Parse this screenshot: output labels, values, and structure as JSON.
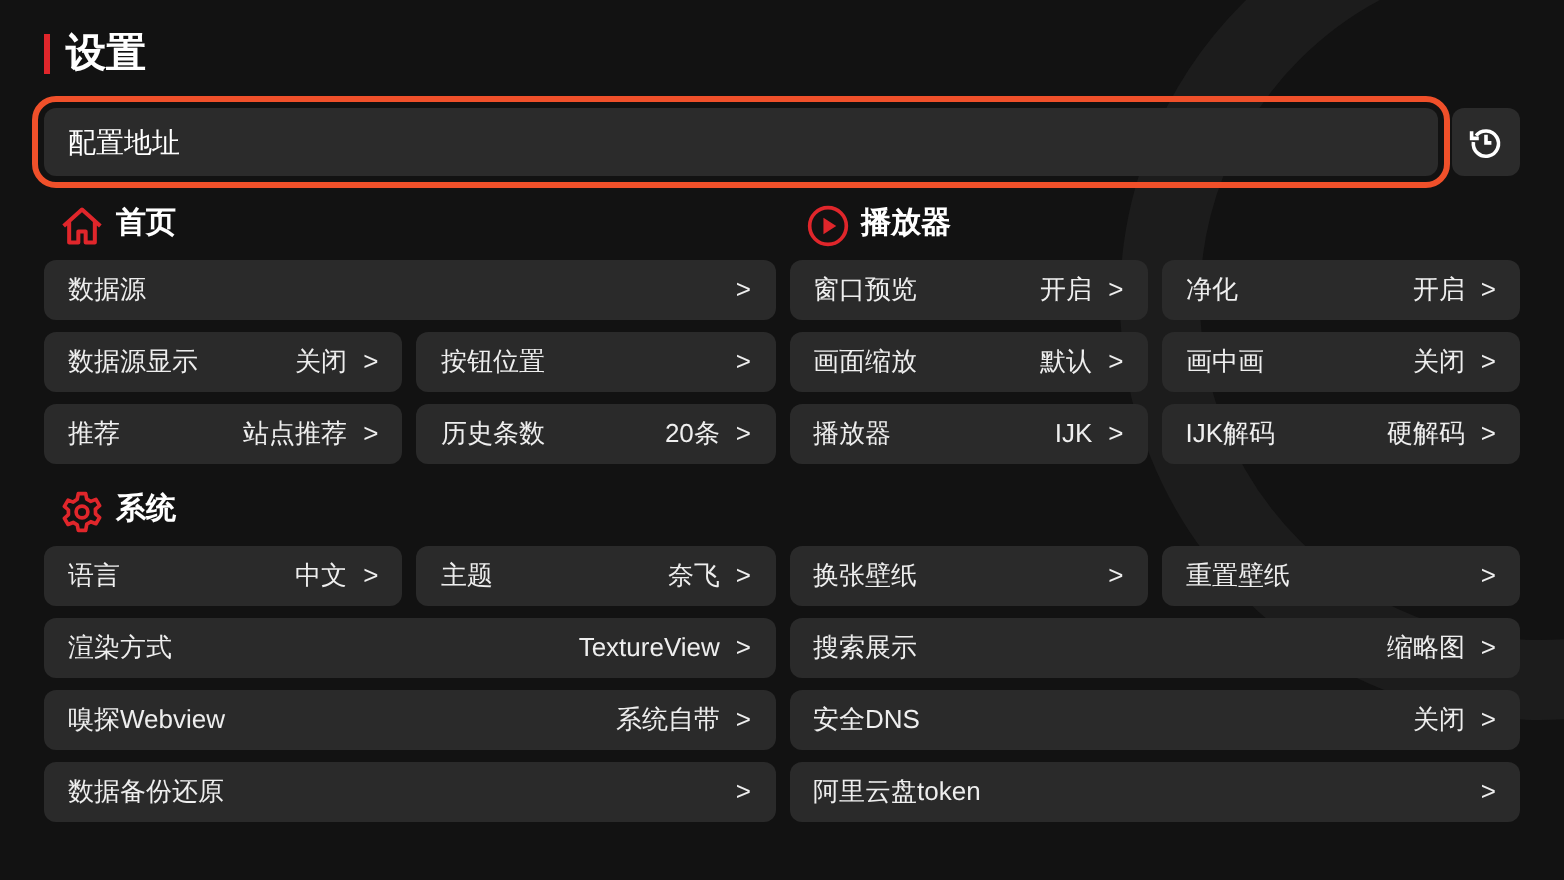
{
  "title": "设置",
  "config_field": {
    "placeholder": "配置地址"
  },
  "left_sections": [
    {
      "title": "首页",
      "kind": "home",
      "rows": [
        [
          {
            "label": "数据源",
            "chevron": ">"
          }
        ],
        [
          {
            "label": "数据源显示",
            "value": "关闭",
            "chevron": ">"
          },
          {
            "label": "按钮位置",
            "chevron": ">"
          }
        ],
        [
          {
            "label": "推荐",
            "value": "站点推荐",
            "chevron": ">"
          },
          {
            "label": "历史条数",
            "value": "20条",
            "chevron": ">"
          }
        ]
      ]
    },
    {
      "title": "系统",
      "kind": "gear",
      "rows": [
        [
          {
            "label": "语言",
            "value": "中文",
            "chevron": ">"
          },
          {
            "label": "主题",
            "value": "奈飞",
            "chevron": ">"
          }
        ],
        [
          {
            "label": "渲染方式",
            "value": "TextureView",
            "chevron": ">"
          }
        ],
        [
          {
            "label": "嗅探Webview",
            "value": "系统自带",
            "chevron": ">"
          }
        ],
        [
          {
            "label": "数据备份还原",
            "chevron": ">"
          }
        ]
      ]
    }
  ],
  "right_sections": [
    {
      "title": "播放器",
      "kind": "play",
      "rows": [
        [
          {
            "label": "窗口预览",
            "value": "开启",
            "chevron": ">"
          },
          {
            "label": "净化",
            "value": "开启",
            "chevron": ">"
          }
        ],
        [
          {
            "label": "画面缩放",
            "value": "默认",
            "chevron": ">"
          },
          {
            "label": "画中画",
            "value": "关闭",
            "chevron": ">"
          }
        ],
        [
          {
            "label": "播放器",
            "value": "IJK",
            "chevron": ">"
          },
          {
            "label": "IJK解码",
            "value": "硬解码",
            "chevron": ">"
          }
        ]
      ]
    },
    {
      "rows": [
        [
          {
            "label": "换张壁纸",
            "chevron": ">"
          },
          {
            "label": "重置壁纸",
            "chevron": ">"
          }
        ],
        [
          {
            "label": "搜索展示",
            "value": "缩略图",
            "chevron": ">"
          }
        ],
        [
          {
            "label": "安全DNS",
            "value": "关闭",
            "chevron": ">"
          }
        ],
        [
          {
            "label": "阿里云盘token",
            "chevron": ">"
          }
        ]
      ]
    }
  ]
}
